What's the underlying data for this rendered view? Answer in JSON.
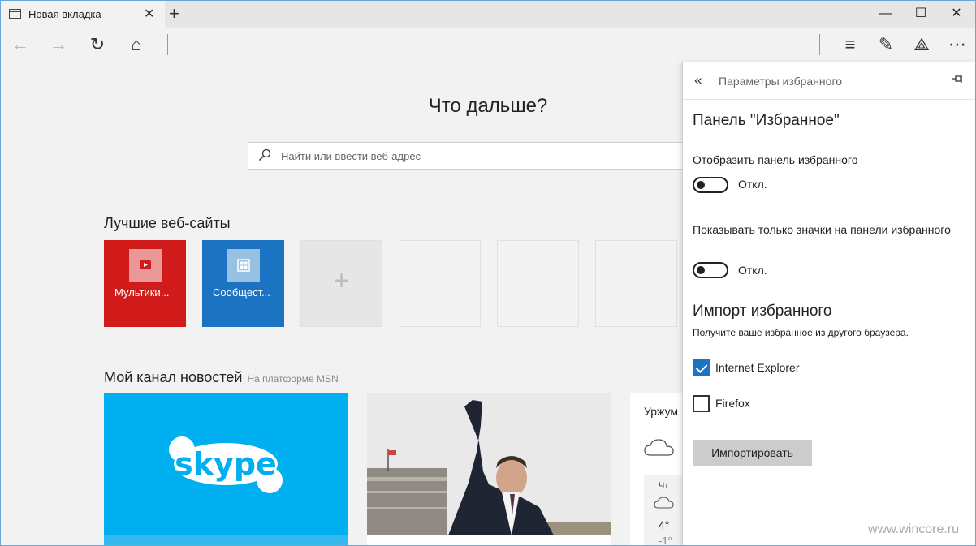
{
  "tab": {
    "title": "Новая вкладка",
    "close": "✕"
  },
  "new_tab_symbol": "+",
  "window_controls": {
    "minimize": "—",
    "maximize": "☐",
    "close": "✕"
  },
  "toolbar": {
    "back": "←",
    "forward": "→",
    "refresh": "↻",
    "home": "⌂",
    "hub": "≡",
    "note": "✎",
    "share": "⟁",
    "more": "⋯"
  },
  "main": {
    "heading": "Что дальше?",
    "search_placeholder": "Найти или ввести веб-адрес",
    "top_sites_title": "Лучшие веб-сайты",
    "tiles": [
      {
        "label": "Мультики...",
        "color": "#d11a1a",
        "icon": "youtube-icon"
      },
      {
        "label": "Сообщест...",
        "color": "#1c73c2",
        "icon": "grid-icon"
      }
    ],
    "add_tile_symbol": "+",
    "news_title": "Мой канал новостей",
    "news_subtitle": "На платформе MSN",
    "skype_label": "skype",
    "weather": {
      "city": "Уржум",
      "day": "Чт",
      "high": "4°",
      "low": "-1°"
    }
  },
  "panel": {
    "title": "Параметры избранного",
    "favorites_bar_heading": "Панель \"Избранное\"",
    "show_bar_label": "Отобразить панель избранного",
    "show_bar_state": "Откл.",
    "icons_only_label": "Показывать только значки на панели избранного",
    "icons_only_state": "Откл.",
    "import_heading": "Импорт избранного",
    "import_desc": "Получите ваше избранное из другого браузера.",
    "browsers": [
      {
        "label": "Internet Explorer",
        "checked": true
      },
      {
        "label": "Firefox",
        "checked": false
      }
    ],
    "import_button": "Импортировать"
  },
  "watermark": "www.wincore.ru",
  "colors": {
    "accent": "#1c73c2",
    "youtube_red": "#d11a1a",
    "skype_blue": "#00aff0"
  }
}
